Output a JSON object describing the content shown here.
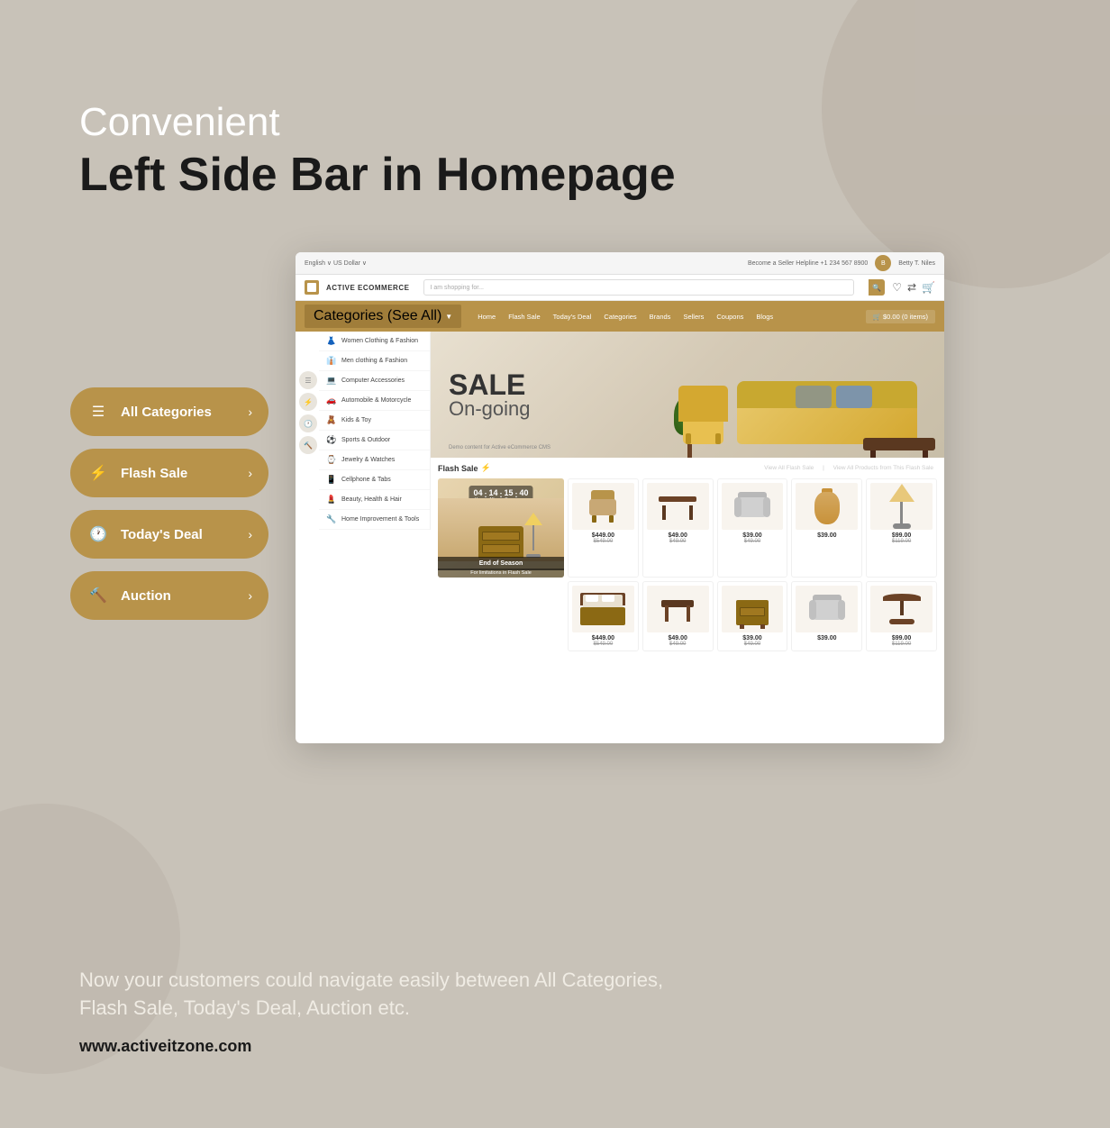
{
  "page": {
    "background_color": "#c8c2b8"
  },
  "header": {
    "convenient_label": "Convenient",
    "main_title": "Left Side Bar in Homepage"
  },
  "sidebar": {
    "pills": [
      {
        "id": "all-categories",
        "icon": "☰",
        "label": "All Categories",
        "has_arrow": true
      },
      {
        "id": "flash-sale",
        "icon": "⚡",
        "label": "Flash Sale",
        "has_arrow": true
      },
      {
        "id": "todays-deal",
        "icon": "🕐",
        "label": "Today's Deal",
        "has_arrow": true
      },
      {
        "id": "auction",
        "icon": "🔨",
        "label": "Auction",
        "has_arrow": true
      }
    ]
  },
  "browser": {
    "topbar": {
      "left_text": "English ∨   US Dollar ∨",
      "right_text": "Become a Seller   Helpline +1 234 567 8900",
      "user_name": "Betty T. Niles"
    },
    "logo": {
      "text": "ACTIVE ECOMMERCE"
    },
    "search": {
      "placeholder": "I am shopping for..."
    },
    "navbar": {
      "categories_label": "Categories  (See All)",
      "links": [
        "Home",
        "Flash Sale",
        "Today's Deal",
        "Categories",
        "Brands",
        "Sellers",
        "Coupons",
        "Blogs"
      ],
      "cart": "$0.00  (0 items)"
    },
    "categories": [
      {
        "icon": "👗",
        "label": "Women Clothing & Fashion"
      },
      {
        "icon": "👔",
        "label": "Men clothing & Fashion"
      },
      {
        "icon": "💻",
        "label": "Computer Accessories"
      },
      {
        "icon": "🚗",
        "label": "Automobile & Motorcycle"
      },
      {
        "icon": "🧸",
        "label": "Kids & Toy"
      },
      {
        "icon": "⚽",
        "label": "Sports & Outdoor"
      },
      {
        "icon": "⌚",
        "label": "Jewelry & Watches"
      },
      {
        "icon": "📱",
        "label": "Cellphone & Tabs"
      },
      {
        "icon": "💄",
        "label": "Beauty, Health & Hair"
      },
      {
        "icon": "🔧",
        "label": "Home Improvement & Tools"
      }
    ],
    "hero": {
      "sale_text": "SALE",
      "ongoing_text": "On-going",
      "demo_text": "Demo content for Active eCommerce CMS"
    },
    "flash_sale": {
      "title": "Flash Sale",
      "icon": "⚡",
      "link1": "View All Flash Sale",
      "link2": "View All Products from This Flash Sale",
      "countdown": {
        "hours": "04",
        "minutes": "14",
        "seconds": "15",
        "milliseconds": "40",
        "h_label": "Hrs",
        "m_label": "Min",
        "s_label": "Sec",
        "ms_label": ""
      },
      "featured_label": "End of Season",
      "flash_sublabel": "For limitations in Flash Sale"
    },
    "products": [
      {
        "price": "$449.00",
        "old_price": "$549.00",
        "type": "chair"
      },
      {
        "price": "$49.00",
        "old_price": "$49.00",
        "type": "table"
      },
      {
        "price": "$39.00",
        "old_price": "$49.00",
        "type": "armchair"
      },
      {
        "price": "$39.00",
        "old_price": "",
        "type": "vase"
      },
      {
        "price": "$99.00",
        "old_price": "$119.00",
        "type": "lamp"
      },
      {
        "price": "$449.00",
        "old_price": "$549.00",
        "type": "bed"
      },
      {
        "price": "$49.00",
        "old_price": "$49.00",
        "type": "stool"
      },
      {
        "price": "$39.00",
        "old_price": "$49.00",
        "type": "nightstand"
      },
      {
        "price": "$39.00",
        "old_price": "",
        "type": "armchair2"
      },
      {
        "price": "$99.00",
        "old_price": "$119.00",
        "type": "roundtable"
      }
    ]
  },
  "bottom": {
    "description": "Now your customers could navigate easily between All Categories,\nFlash Sale, Today's Deal, Auction etc.",
    "url": "www.activeitzone.com"
  }
}
